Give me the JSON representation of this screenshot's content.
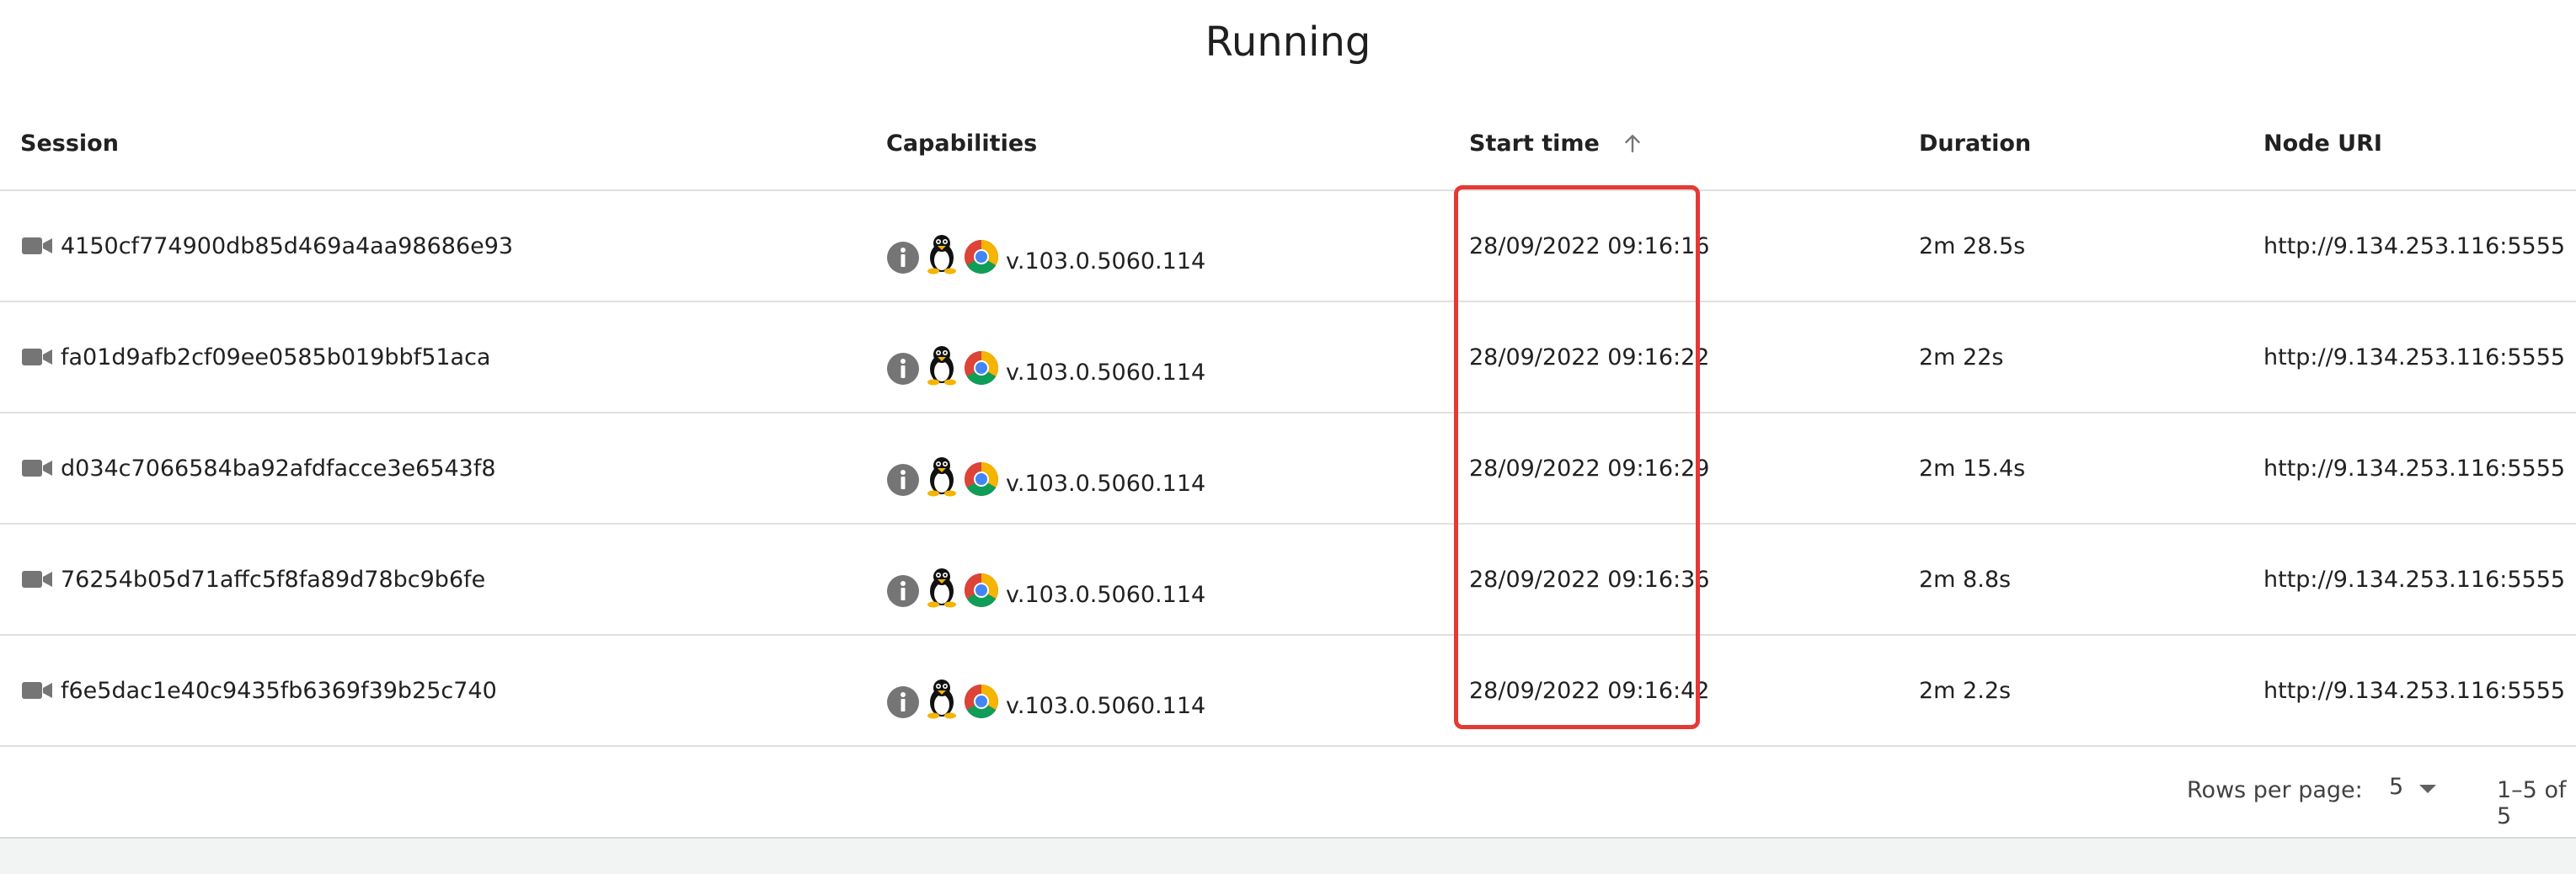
{
  "title": "Running",
  "columns": {
    "session": "Session",
    "capabilities": "Capabilities",
    "start_time": "Start time",
    "duration": "Duration",
    "node_uri": "Node URI"
  },
  "rows": [
    {
      "session": "4150cf774900db85d469a4aa98686e93",
      "version": "v.103.0.5060.114",
      "start": "28/09/2022 09:16:16",
      "duration": "2m 28.5s",
      "node": "http://9.134.253.116:5555"
    },
    {
      "session": "fa01d9afb2cf09ee0585b019bbf51aca",
      "version": "v.103.0.5060.114",
      "start": "28/09/2022 09:16:22",
      "duration": "2m 22s",
      "node": "http://9.134.253.116:5555"
    },
    {
      "session": "d034c7066584ba92afdfacce3e6543f8",
      "version": "v.103.0.5060.114",
      "start": "28/09/2022 09:16:29",
      "duration": "2m 15.4s",
      "node": "http://9.134.253.116:5555"
    },
    {
      "session": "76254b05d71affc5f8fa89d78bc9b6fe",
      "version": "v.103.0.5060.114",
      "start": "28/09/2022 09:16:36",
      "duration": "2m 8.8s",
      "node": "http://9.134.253.116:5555"
    },
    {
      "session": "f6e5dac1e40c9435fb6369f39b25c740",
      "version": "v.103.0.5060.114",
      "start": "28/09/2022 09:16:42",
      "duration": "2m 2.2s",
      "node": "http://9.134.253.116:5555"
    }
  ],
  "pagination": {
    "rows_per_page_label": "Rows per page:",
    "rows_per_page_value": "5",
    "range": "1–5 of 5"
  },
  "icons": {
    "session": "video-camera-icon",
    "info": "info-icon",
    "os": "linux-tux-icon",
    "browser": "chrome-icon",
    "sort": "arrow-up-icon",
    "dropdown": "caret-down-icon"
  },
  "colors": {
    "highlight": "#e53935",
    "text": "#212121",
    "divider": "#e0e0e0",
    "icon_gray": "#616161"
  }
}
